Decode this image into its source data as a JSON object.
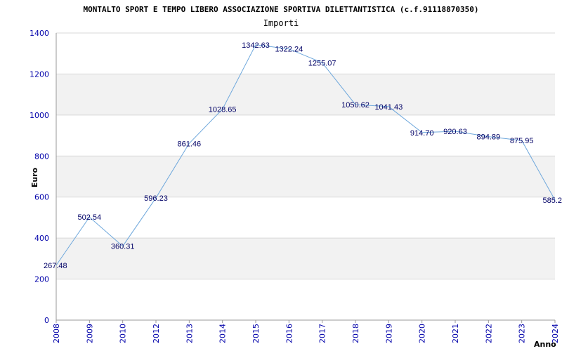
{
  "chart_data": {
    "type": "line",
    "title": "MONTALTO SPORT E TEMPO LIBERO ASSOCIAZIONE SPORTIVA DILETTANTISTICA (c.f.91118870350)",
    "subtitle": "Importi",
    "xlabel": "Anno",
    "ylabel": "Euro",
    "ylim": [
      0,
      1400
    ],
    "yticks": [
      0,
      200,
      400,
      600,
      800,
      1000,
      1200,
      1400
    ],
    "grid": true,
    "colors": {
      "line": "#6fa8dc",
      "band": "#f2f2f2",
      "grid": "#d9d9d9",
      "axis": "#999999",
      "tick_text": "#0000aa",
      "label_text": "#000066"
    },
    "x": [
      "2008",
      "2009",
      "2010",
      "2012",
      "2013",
      "2014",
      "2015",
      "2016",
      "2017",
      "2018",
      "2019",
      "2020",
      "2021",
      "2022",
      "2023",
      "2024"
    ],
    "values": [
      267.48,
      502.54,
      360.31,
      596.23,
      861.46,
      1028.65,
      1342.63,
      1322.24,
      1255.07,
      1050.62,
      1041.43,
      914.7,
      920.63,
      894.89,
      875.95,
      585.2
    ],
    "labels": [
      "267.48",
      "502.54",
      "360.31",
      "596.23",
      "861.46",
      "1028.65",
      "1342.63",
      "1322.24",
      "1255.07",
      "1050.62",
      "1041.43",
      "914.70",
      "920.63",
      "894.89",
      "875.95",
      "585.2"
    ]
  }
}
